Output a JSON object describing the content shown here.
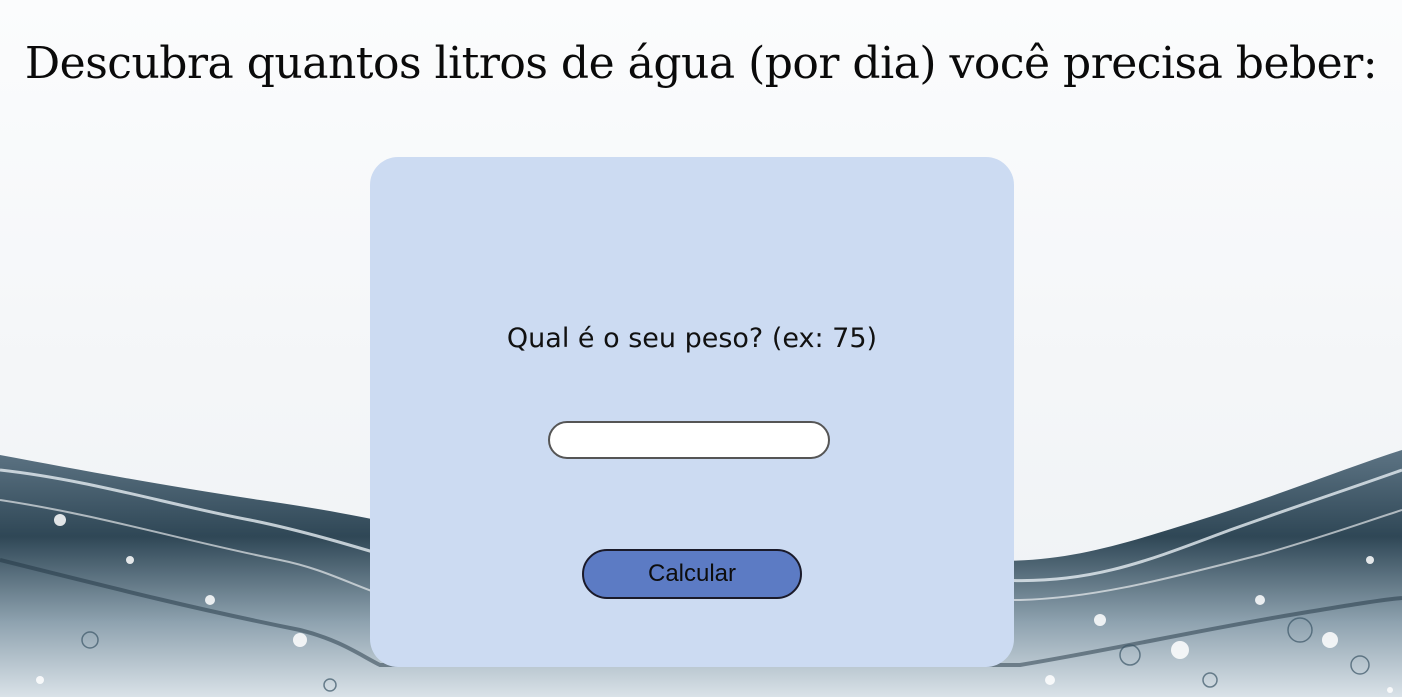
{
  "header": {
    "title": "Descubra quantos litros de água (por dia) você precisa beber:"
  },
  "form": {
    "question_label": "Qual é o seu peso? (ex: 75)",
    "weight_input_value": "",
    "calculate_label": "Calcular"
  },
  "colors": {
    "card_background": "#ccdbf2",
    "button_background": "#5c7bc4",
    "water_dark": "#2f4756"
  }
}
